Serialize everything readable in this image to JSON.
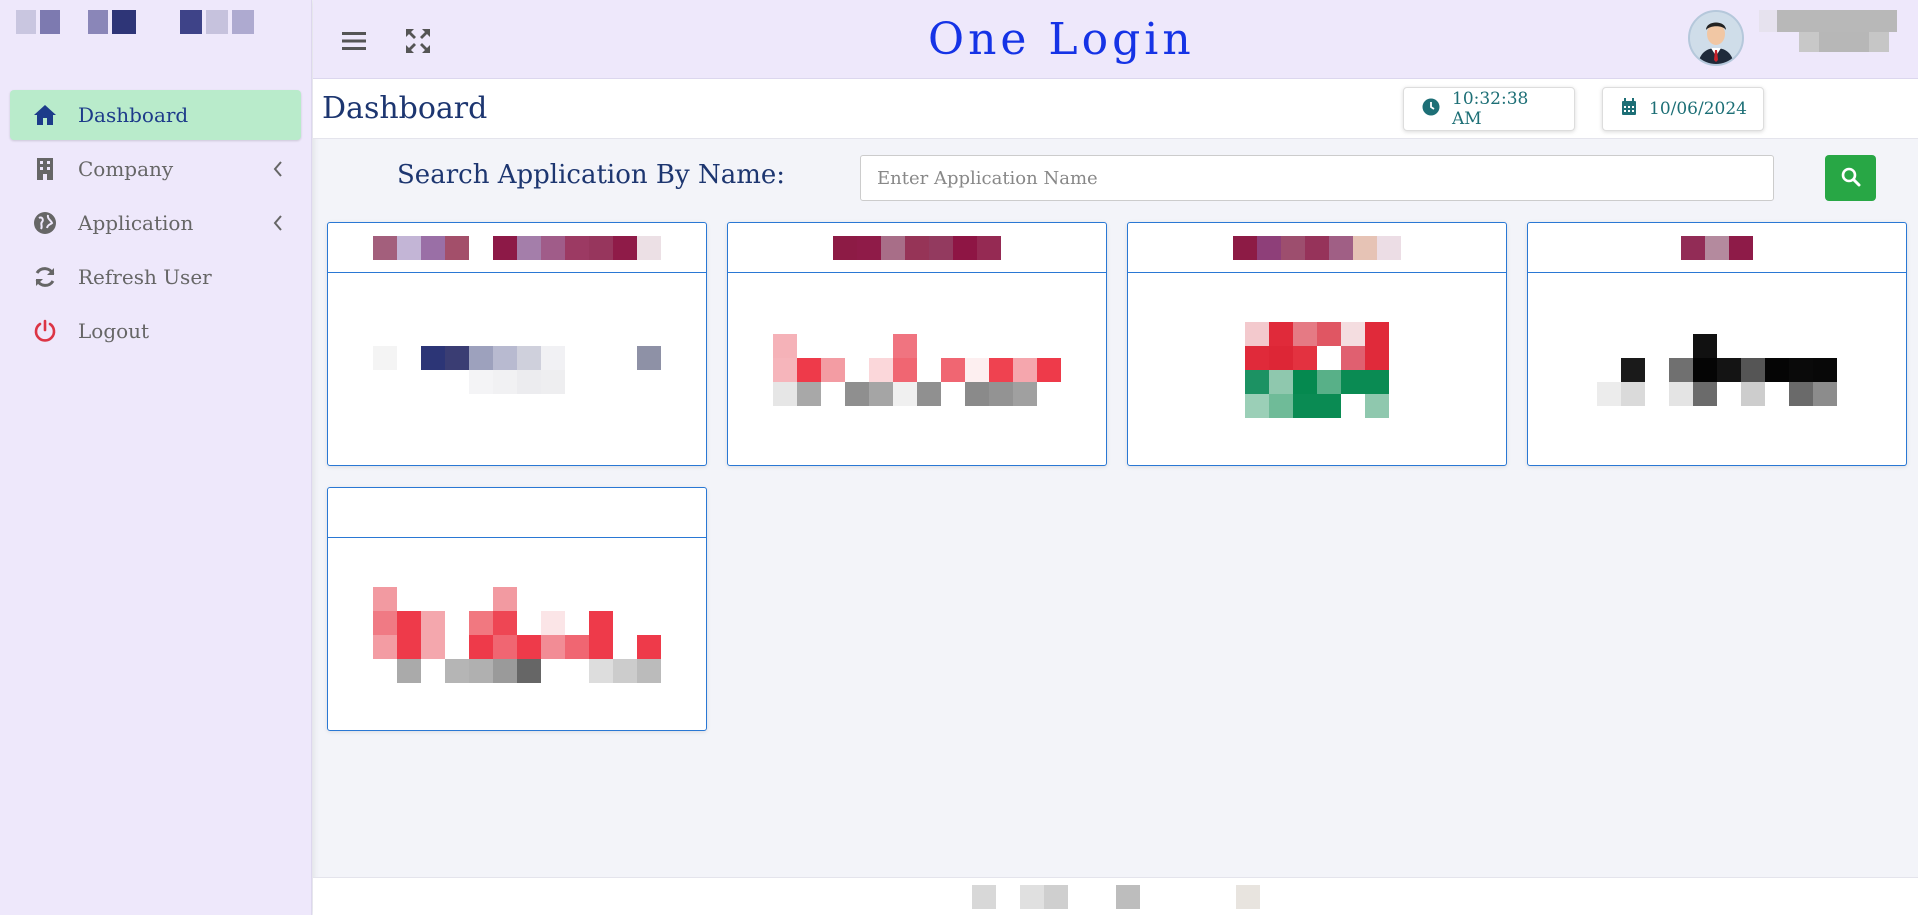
{
  "header": {
    "title": "One Login",
    "menu_icon": "hamburger-menu-icon",
    "fullscreen_icon": "expand-arrows-icon"
  },
  "sidebar": {
    "items": [
      {
        "label": "Dashboard",
        "icon": "home-icon",
        "active": true,
        "has_submenu": false
      },
      {
        "label": "Company",
        "icon": "building-icon",
        "active": false,
        "has_submenu": true
      },
      {
        "label": "Application",
        "icon": "globe-icon",
        "active": false,
        "has_submenu": true
      },
      {
        "label": "Refresh User",
        "icon": "sync-icon",
        "active": false,
        "has_submenu": false
      },
      {
        "label": "Logout",
        "icon": "power-icon",
        "active": false,
        "has_submenu": false
      }
    ]
  },
  "page": {
    "title": "Dashboard",
    "time": "10:32:38 AM",
    "date": "10/06/2024"
  },
  "search": {
    "label": "Search Application By Name:",
    "placeholder": "Enter Application Name",
    "value": ""
  },
  "colors": {
    "accent_blue": "#1533e6",
    "active_nav_bg": "#b9ebcb",
    "search_button": "#28a745",
    "card_border": "#2a78d4",
    "header_bg": "#eee8fb"
  }
}
